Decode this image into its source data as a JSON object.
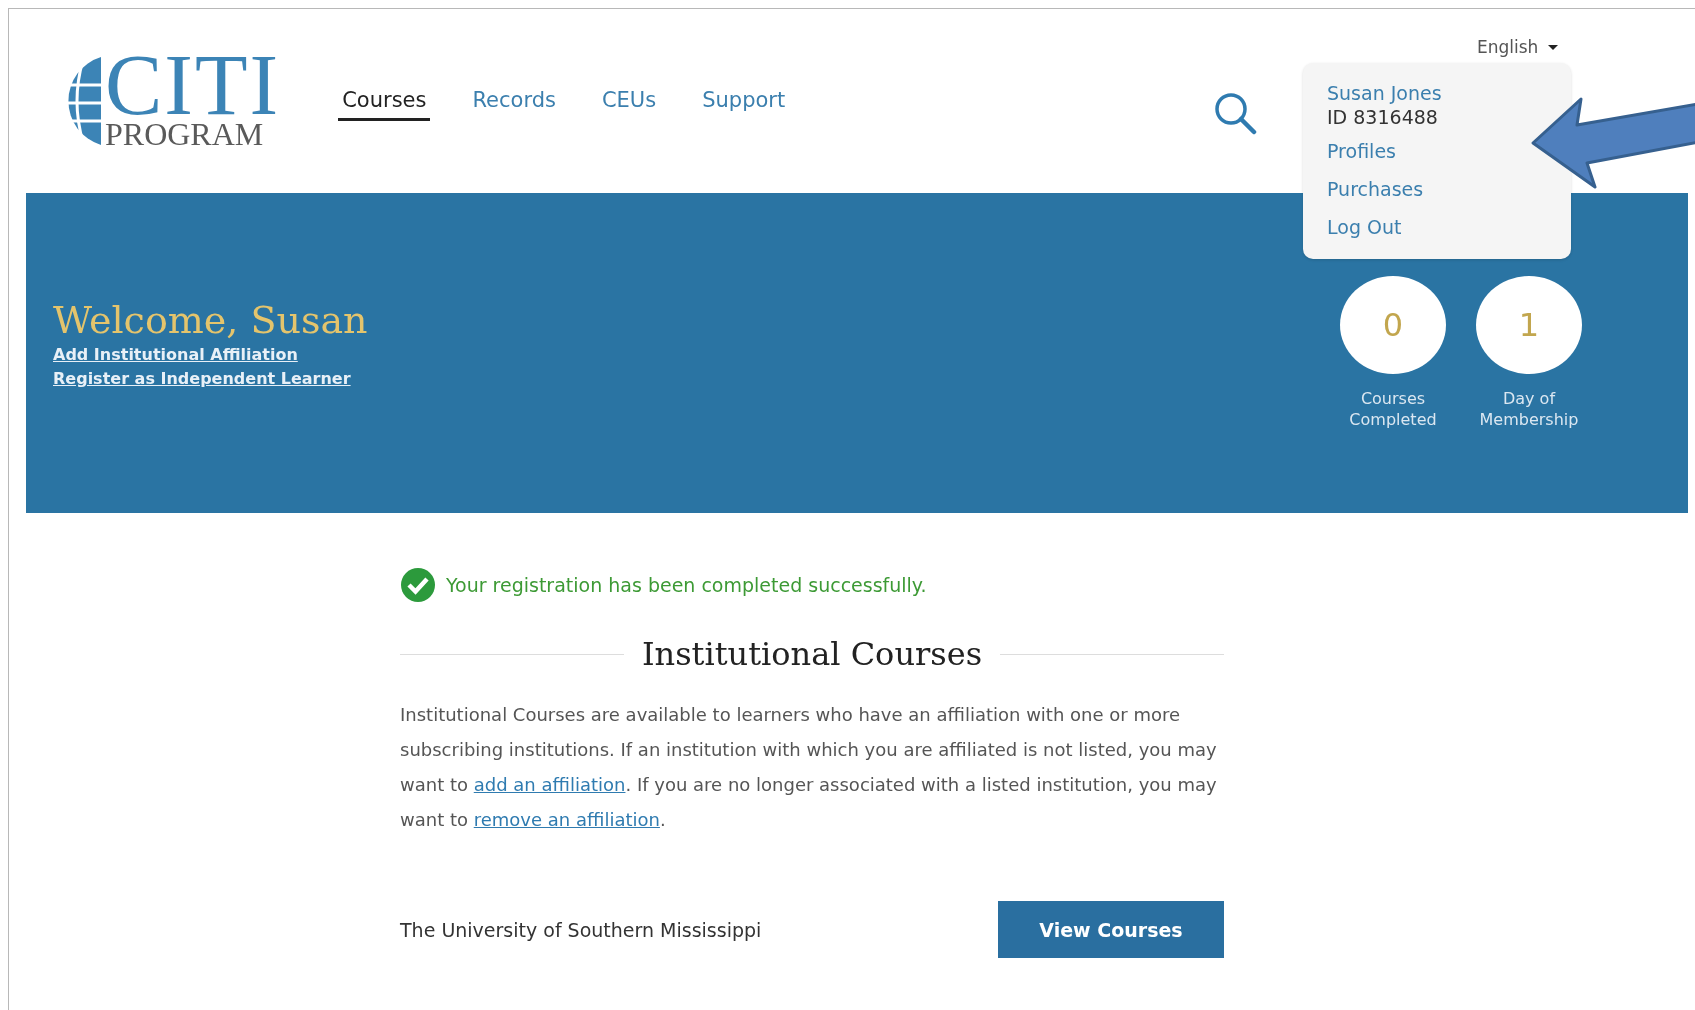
{
  "logo": {
    "title": "CITI",
    "subtitle": "PROGRAM"
  },
  "nav": [
    {
      "label": "Courses",
      "selected": true
    },
    {
      "label": "Records",
      "selected": false
    },
    {
      "label": "CEUs",
      "selected": false
    },
    {
      "label": "Support",
      "selected": false
    }
  ],
  "language": "English",
  "user_menu": {
    "name": "Susan Jones",
    "id": "ID 8316488",
    "items": [
      "Profiles",
      "Purchases",
      "Log Out"
    ]
  },
  "banner": {
    "welcome": "Welcome, Susan",
    "links": [
      "Add Institutional Affiliation",
      "Register as Independent Learner"
    ],
    "stats": [
      {
        "value": "0",
        "label": "Courses Completed"
      },
      {
        "value": "1",
        "label": "Day of Membership"
      }
    ]
  },
  "alert": {
    "kind": "success",
    "text": "Your registration has been completed successfully."
  },
  "section": {
    "title": "Institutional Courses",
    "description": [
      {
        "kind": "text",
        "text": "Institutional Courses are available to learners who have an affiliation with one or more subscribing institutions. If an institution with which you are affiliated is not listed, you may want to "
      },
      {
        "kind": "link",
        "text": "add an affiliation"
      },
      {
        "kind": "text",
        "text": ". If you are no longer associated with a listed institution, you may want to "
      },
      {
        "kind": "link",
        "text": "remove an affiliation"
      },
      {
        "kind": "text",
        "text": "."
      }
    ]
  },
  "institutions": [
    {
      "name": "The University of Southern Mississippi",
      "action": "View Courses"
    }
  ]
}
